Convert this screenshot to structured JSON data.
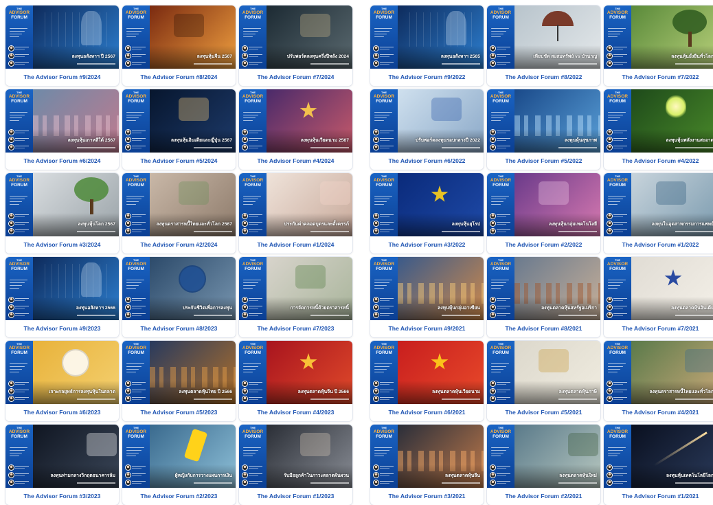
{
  "brand": {
    "logo_line1": "THE",
    "logo_line2": "ADVISOR",
    "logo_line3": "FORUM"
  },
  "left_column": [
    {
      "title": "The Advisor Forum #9/2024",
      "topic": "ลงทุนอสังหาฯ ปี 2567",
      "bg": [
        "#0e2b5c",
        "#2d7fd0"
      ],
      "accent": "#6fd3ff",
      "motif": "chart-icon"
    },
    {
      "title": "The Advisor Forum #8/2024",
      "topic": "ลงทุนหุ้นจีน 2567",
      "bg": [
        "#7a2a10",
        "#f0a040"
      ],
      "accent": "#3a1a08",
      "motif": "great-wall-icon"
    },
    {
      "title": "The Advisor Forum #7/2024",
      "topic": "ปรับพอร์ตลงทุนครึ่งปีหลัง 2024",
      "bg": [
        "#1c2a33",
        "#5b6a70"
      ],
      "accent": "#c8b48a",
      "motif": "pen-document-icon"
    },
    {
      "title": "The Advisor Forum #6/2024",
      "topic": "ลงทุนหุ้นเกาหลีใต้ 2567",
      "bg": [
        "#6f8aa8",
        "#c07a8e"
      ],
      "accent": "#e7c2d0",
      "motif": "city-skyline-icon"
    },
    {
      "title": "The Advisor Forum #5/2024",
      "topic": "ลงทุนหุ้นอินเดียและญี่ปุ่น 2567",
      "bg": [
        "#07162e",
        "#1d3a6a"
      ],
      "accent": "#ffd27a",
      "motif": "earth-night-icon"
    },
    {
      "title": "The Advisor Forum #4/2024",
      "topic": "ลงทุนหุ้นเวียดนาม 2567",
      "bg": [
        "#4a2a6a",
        "#c85a6a"
      ],
      "accent": "#ffcf4a",
      "motif": "flag-vietnam-icon"
    },
    {
      "title": "The Advisor Forum #3/2024",
      "topic": "ลงทุนหุ้นโลก 2567",
      "bg": [
        "#d9dde0",
        "#9aa3a8"
      ],
      "accent": "#4d8a3a",
      "motif": "growing-trees-icon"
    },
    {
      "title": "The Advisor Forum #2/2024",
      "topic": "ลงทุนตราสารหนี้ไทยและทั่วโลก 2567",
      "bg": [
        "#c9b8a8",
        "#8d7a6a"
      ],
      "accent": "#6a8e5a",
      "motif": "hands-money-icon"
    },
    {
      "title": "The Advisor Forum #1/2024",
      "topic": "ประกันค่าคลอดบุตรและตั้งครรภ์",
      "bg": [
        "#efe3da",
        "#c8a99a"
      ],
      "accent": "#f5d7cc",
      "motif": "pregnancy-icon"
    },
    {
      "title": "The Advisor Forum #9/2023",
      "topic": "ลงทุนอสังหาฯ 2566",
      "bg": [
        "#0e2b5c",
        "#2d7fd0"
      ],
      "accent": "#6fd3ff",
      "motif": "chart-icon"
    },
    {
      "title": "The Advisor Forum #8/2023",
      "topic": "ประกันชีวิตเพื่อการลงทุน",
      "bg": [
        "#2c4a6a",
        "#7896b0"
      ],
      "accent": "#1d4e94",
      "motif": "piggy-bank-icon"
    },
    {
      "title": "The Advisor Forum #7/2023",
      "topic": "การจัดการหนี้ด้วยตราสารหนี้",
      "bg": [
        "#d8d4cc",
        "#a8b49a"
      ],
      "accent": "#4f7a3e",
      "motif": "debt-blocks-icon"
    },
    {
      "title": "The Advisor Forum #6/2023",
      "topic": "เจาะกลยุทธ์การลงทุนหุ้นในตลาด",
      "bg": [
        "#e8b23a",
        "#f4d070"
      ],
      "accent": "#ffffff",
      "motif": "clock-icon"
    },
    {
      "title": "The Advisor Forum #5/2023",
      "topic": "ลงทุนตลาดหุ้นไทย ปี 2566",
      "bg": [
        "#283a5e",
        "#b0702a"
      ],
      "accent": "#e8a04a",
      "motif": "bangkok-skyline-icon"
    },
    {
      "title": "The Advisor Forum #4/2023",
      "topic": "ลงทุนตลาดหุ้นจีน ปี 2566",
      "bg": [
        "#a8141e",
        "#e04a2a"
      ],
      "accent": "#ffd23a",
      "motif": "flag-china-icon"
    },
    {
      "title": "The Advisor Forum #3/2023",
      "topic": "ลงทุนท่ามกลางวิกฤตธนาคารล้ม",
      "bg": [
        "#101622",
        "#3a4658"
      ],
      "accent": "#ffffff",
      "motif": "bank-sign-icon"
    },
    {
      "title": "The Advisor Forum #2/2023",
      "topic": "ผู้หญิงกับการวางแผนการเงิน",
      "bg": [
        "#3a6a8e",
        "#8ec0d8"
      ],
      "accent": "#ffd21a",
      "motif": "phone-icon"
    },
    {
      "title": "The Advisor Forum #1/2023",
      "topic": "รับมือลูกค้าในภาวะตลาดผันผวน",
      "bg": [
        "#2a2e36",
        "#8a8e96"
      ],
      "accent": "#d8c8b8",
      "motif": "woman-laptop-icon"
    }
  ],
  "right_column": [
    {
      "title": "The Advisor Forum #9/2022",
      "topic": "ลงทุนอสังหาฯ 2565",
      "bg": [
        "#0e2b5c",
        "#2d7fd0"
      ],
      "accent": "#6fd3ff",
      "motif": "chart-icon"
    },
    {
      "title": "The Advisor Forum #8/2022",
      "topic": "เทียบชัด สะสมทรัพย์ vs บำนาญ",
      "bg": [
        "#b8c4cc",
        "#e4e8ea"
      ],
      "accent": "#7a3a2a",
      "motif": "umbrella-icon"
    },
    {
      "title": "The Advisor Forum #7/2022",
      "topic": "ลงทุนหุ้นยั่งยืนทั่วโลก",
      "bg": [
        "#5a8a3a",
        "#b8d07a"
      ],
      "accent": "#2e5a1e",
      "motif": "tree-icon"
    },
    {
      "title": "The Advisor Forum #6/2022",
      "topic": "ปรับพอร์ตลงทุนรอบกลางปี 2022",
      "bg": [
        "#cfe0ee",
        "#8aa8c8"
      ],
      "accent": "#2a5aa8",
      "motif": "tablet-chart-icon"
    },
    {
      "title": "The Advisor Forum #5/2022",
      "topic": "ลงทุนหุ้นสุขภาพ",
      "bg": [
        "#1a4a8a",
        "#5aa0d8"
      ],
      "accent": "#bfe4ff",
      "motif": "isometric-city-icon"
    },
    {
      "title": "The Advisor Forum #4/2022",
      "topic": "ลงทุนหุ้นพลังงานสะอาด",
      "bg": [
        "#1e4a1a",
        "#4a8a2a"
      ],
      "accent": "#d8f06a",
      "motif": "light-bulb-icon"
    },
    {
      "title": "The Advisor Forum #3/2022",
      "topic": "ลงทุนหุ้นยุโรป",
      "bg": [
        "#0a2a7a",
        "#1e4aa8"
      ],
      "accent": "#ffd21a",
      "motif": "flag-eu-icon"
    },
    {
      "title": "The Advisor Forum #2/2022",
      "topic": "ลงทุนหุ้นกลุ่มเทคโนโลยี",
      "bg": [
        "#6a3a8a",
        "#d87ab0"
      ],
      "accent": "#f2c8e8",
      "motif": "chip-wafer-icon"
    },
    {
      "title": "The Advisor Forum #1/2022",
      "topic": "ลงทุนในอุตสาหกรรมการแพทย์",
      "bg": [
        "#c8d4dc",
        "#7a9aae"
      ],
      "accent": "#2a5a7a",
      "motif": "lab-icon"
    },
    {
      "title": "The Advisor Forum #9/2021",
      "topic": "ลงทุนหุ้นกลุ่มอาเซียน",
      "bg": [
        "#3a5a8a",
        "#d08a4a"
      ],
      "accent": "#ffd07a",
      "motif": "city-skyline-icon"
    },
    {
      "title": "The Advisor Forum #8/2021",
      "topic": "ลงทุนตลาดหุ้นสหรัฐอเมริกา",
      "bg": [
        "#6a7a8e",
        "#c8b098"
      ],
      "accent": "#a0542a",
      "motif": "city-aerial-icon"
    },
    {
      "title": "The Advisor Forum #7/2021",
      "topic": "ลงทุนตลาดหุ้นอินเดีย",
      "bg": [
        "#e0dcd4",
        "#f4f0e8"
      ],
      "accent": "#14399a",
      "motif": "flag-india-icon"
    },
    {
      "title": "The Advisor Forum #6/2021",
      "topic": "ลงทุนตลาดหุ้นเวียดนาม",
      "bg": [
        "#c81e1e",
        "#e84a2a"
      ],
      "accent": "#ffd21a",
      "motif": "flag-vietnam-icon"
    },
    {
      "title": "The Advisor Forum #5/2021",
      "topic": "ลงทุนตลาดหุ้นภาษี",
      "bg": [
        "#dcd8cc",
        "#f0ece0"
      ],
      "accent": "#c89a3a",
      "motif": "tax-blocks-icon"
    },
    {
      "title": "The Advisor Forum #4/2021",
      "topic": "ลงทุนตราสารหนี้ไทยและทั่วโลก",
      "bg": [
        "#5a7a4a",
        "#c8a878"
      ],
      "accent": "#3a6a8e",
      "motif": "banknotes-icon"
    },
    {
      "title": "The Advisor Forum #3/2021",
      "topic": "ลงทุนตลาดหุ้นจีน",
      "bg": [
        "#2a2e3a",
        "#c07a4a"
      ],
      "accent": "#ffb06a",
      "motif": "city-sunset-icon"
    },
    {
      "title": "The Advisor Forum #2/2021",
      "topic": "ลงทุนตลาดหุ้นใหม่",
      "bg": [
        "#5a7a8a",
        "#b8c8c0"
      ],
      "accent": "#3a5a3a",
      "motif": "mountains-icon"
    },
    {
      "title": "The Advisor Forum #1/2021",
      "topic": "ลงทุนหุ้นเทคโนโลยีโลก",
      "bg": [
        "#0a1020",
        "#2a3a5a"
      ],
      "accent": "#ffe0a0",
      "motif": "rocket-launch-icon"
    }
  ]
}
